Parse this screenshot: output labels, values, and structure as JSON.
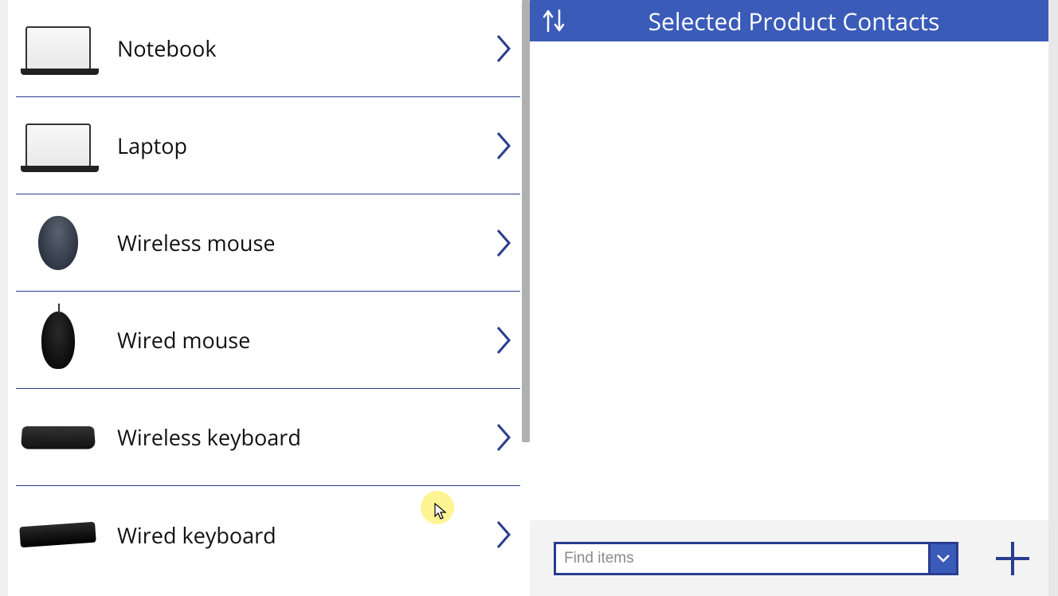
{
  "products": [
    {
      "label": "Notebook",
      "icon": "notebook-thumb"
    },
    {
      "label": "Laptop",
      "icon": "laptop-thumb"
    },
    {
      "label": "Wireless mouse",
      "icon": "wireless-mouse-thumb"
    },
    {
      "label": "Wired mouse",
      "icon": "wired-mouse-thumb"
    },
    {
      "label": "Wireless keyboard",
      "icon": "wireless-keyboard-thumb"
    },
    {
      "label": "Wired keyboard",
      "icon": "wired-keyboard-thumb"
    }
  ],
  "right": {
    "title": "Selected Product Contacts",
    "find_placeholder": "Find items"
  },
  "colors": {
    "primary": "#3a5bb8",
    "primary_dark": "#2a3c8f"
  }
}
